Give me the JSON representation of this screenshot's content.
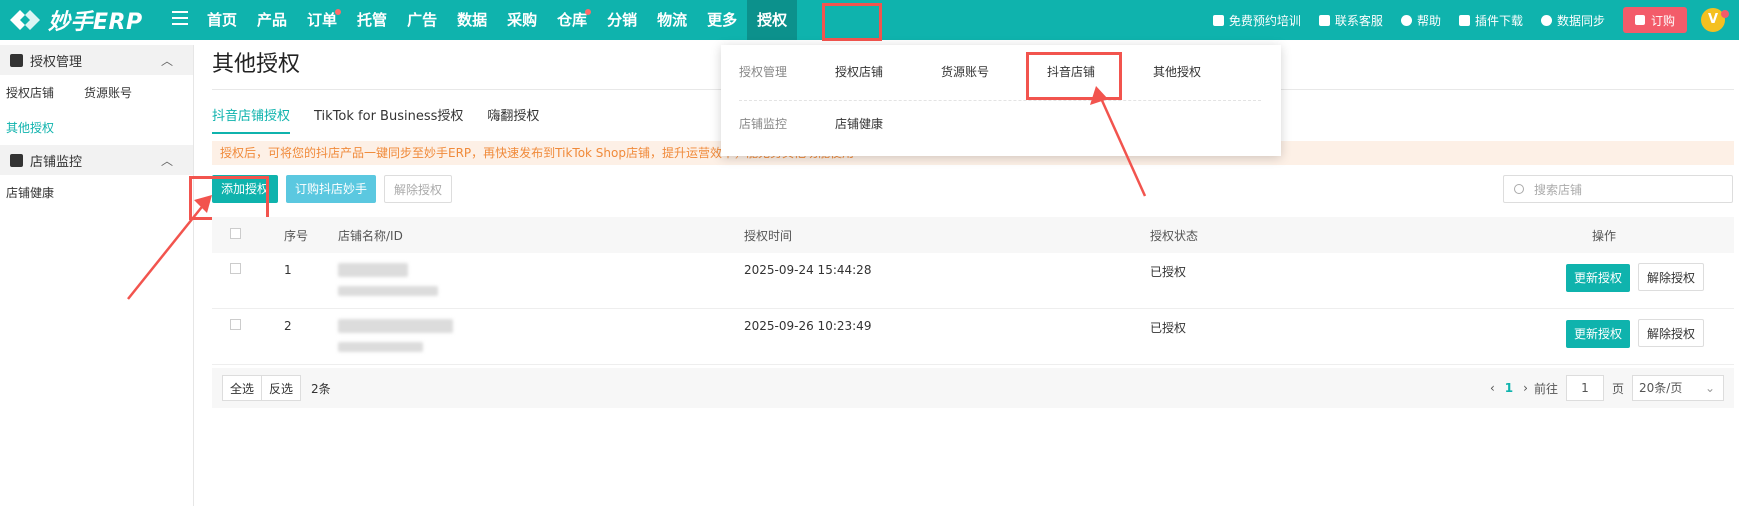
{
  "app": {
    "brand": "妙手ERP"
  },
  "nav": {
    "items": [
      {
        "label": "首页",
        "dot": false
      },
      {
        "label": "产品",
        "dot": false
      },
      {
        "label": "订单",
        "dot": true
      },
      {
        "label": "托管",
        "dot": false
      },
      {
        "label": "广告",
        "dot": false
      },
      {
        "label": "数据",
        "dot": false
      },
      {
        "label": "采购",
        "dot": false
      },
      {
        "label": "仓库",
        "dot": true
      },
      {
        "label": "分销",
        "dot": false
      },
      {
        "label": "物流",
        "dot": false
      },
      {
        "label": "更多",
        "dot": false
      },
      {
        "label": "授权",
        "dot": false
      }
    ],
    "active": "授权"
  },
  "tools": {
    "training": "免费预约培训",
    "support": "联系客服",
    "help": "帮助",
    "plugin": "插件下载",
    "sync": "数据同步",
    "order": "订购",
    "avatar": "V"
  },
  "sidebar": {
    "group1": "授权管理",
    "group1_items": [
      "授权店铺",
      "货源账号"
    ],
    "group1_active": "其他授权",
    "group2": "店铺监控",
    "group2_items": [
      "店铺健康"
    ]
  },
  "page": {
    "title": "其他授权",
    "tabs": [
      "抖音店铺授权",
      "TikTok for Business授权",
      "嗨翻授权"
    ],
    "notice": "授权后，可将您的抖店产品一键同步至妙手ERP，再快速发布到TikTok Shop店铺，提升运营效率，能无务其他功能使用",
    "buttons": {
      "add": "添加授权",
      "subscribe": "订购抖店妙手",
      "revoke": "解除授权"
    },
    "search_placeholder": "搜索店铺"
  },
  "table": {
    "headers": [
      "序号",
      "店铺名称/ID",
      "授权时间",
      "授权状态",
      "操作"
    ],
    "rows": [
      {
        "no": "1",
        "time": "2025-09-24 15:44:28",
        "status": "已授权",
        "op1": "更新授权",
        "op2": "解除授权"
      },
      {
        "no": "2",
        "time": "2025-09-26 10:23:49",
        "status": "已授权",
        "op1": "更新授权",
        "op2": "解除授权"
      }
    ]
  },
  "footer": {
    "select_all": "全选",
    "invert": "反选",
    "count": "2条",
    "page": "1",
    "goto": "前往",
    "goto_value": "1",
    "page_unit": "页",
    "per_page": "20条/页"
  },
  "dropdown": {
    "row1_cat": "授权管理",
    "row1_items": [
      "授权店铺",
      "货源账号",
      "抖音店铺",
      "其他授权"
    ],
    "row2_cat": "店铺监控",
    "row2_items": [
      "店铺健康"
    ]
  },
  "colors": {
    "accent": "#0fb3ad",
    "highlight": "#f2544e",
    "order": "#f35c6a"
  }
}
